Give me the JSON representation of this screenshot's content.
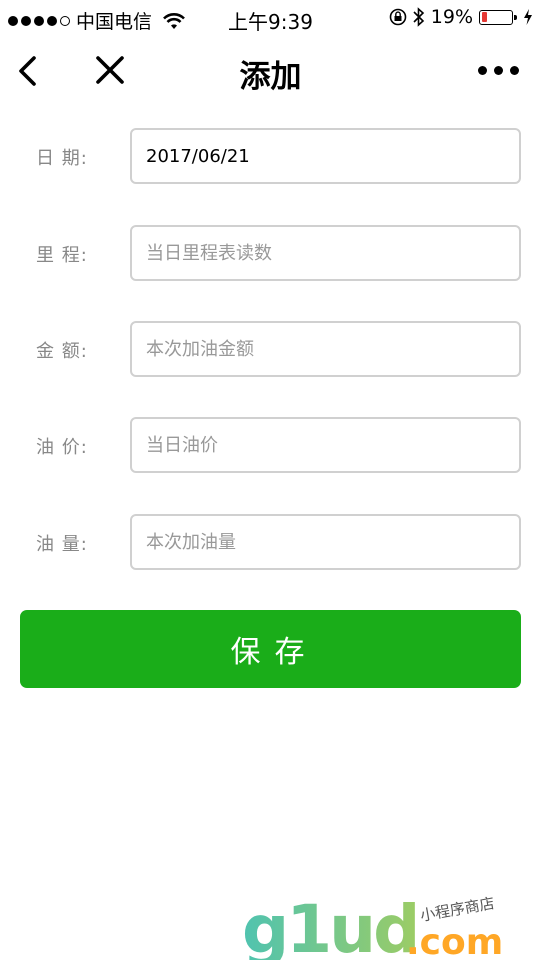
{
  "status_bar": {
    "carrier": "中国电信",
    "time": "上午9:39",
    "battery_percent": "19%",
    "battery_level": 0.19
  },
  "nav": {
    "title": "添加",
    "back_icon": "chevron-left-icon",
    "close_icon": "close-icon",
    "more_icon": "more-horizontal-icon"
  },
  "form": {
    "fields": [
      {
        "label": "日 期:",
        "value": "2017/06/21",
        "placeholder": ""
      },
      {
        "label": "里 程:",
        "value": "",
        "placeholder": "当日里程表读数"
      },
      {
        "label": "金 额:",
        "value": "",
        "placeholder": "本次加油金额"
      },
      {
        "label": "油 价:",
        "value": "",
        "placeholder": "当日油价"
      },
      {
        "label": "油 量:",
        "value": "",
        "placeholder": "本次加油量"
      }
    ],
    "save_label": "保存"
  },
  "watermark": {
    "brand": "g1ud",
    "suffix": ".com",
    "tagline": "小程序商店"
  },
  "colors": {
    "primary": "#1aad19",
    "battery_low": "#e53935",
    "label_gray": "#888888",
    "border_gray": "#d0d0d0"
  }
}
